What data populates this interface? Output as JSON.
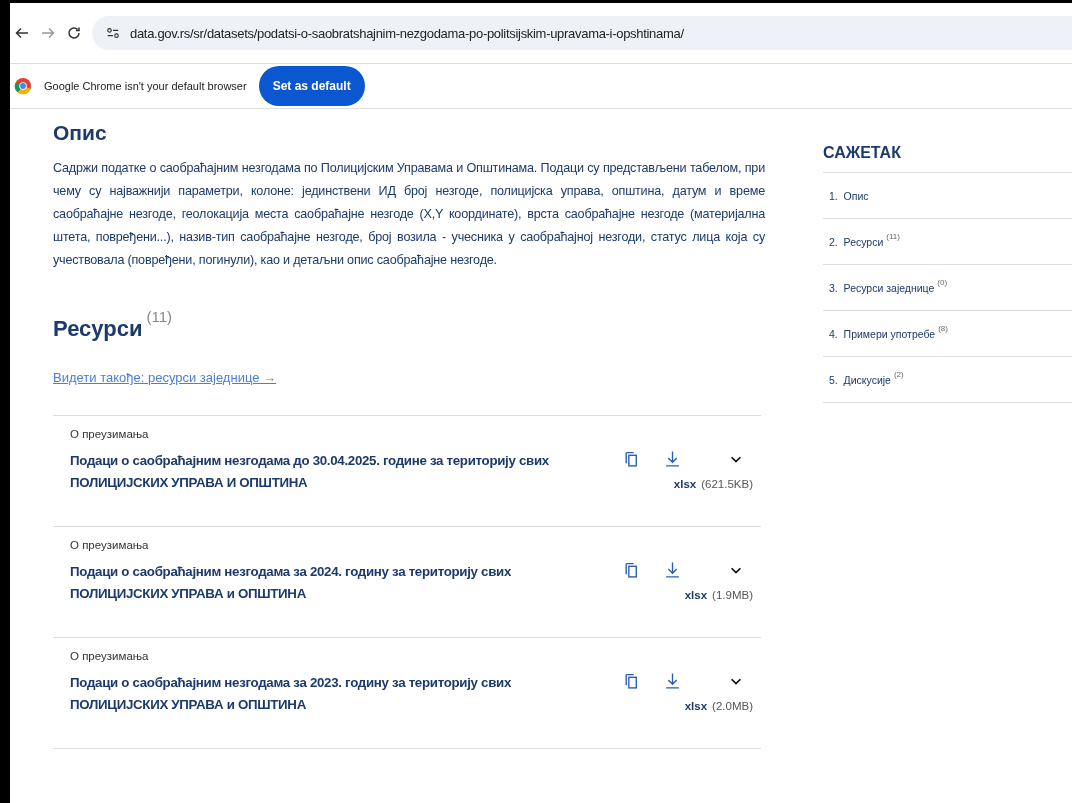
{
  "browser": {
    "url": "data.gov.rs/sr/datasets/podatsi-o-saobratshajnim-nezgodama-po-politsijskim-upravama-i-opshtinama/"
  },
  "infobar": {
    "message": "Google Chrome isn't your default browser",
    "button": "Set as default"
  },
  "description": {
    "heading": "Опис",
    "text": "Садржи податке о саобраћајним незгодама по Полицијским Управама и Општинама. Подаци су представљени табелом, при чему су најважнији параметри, колоне: јединствени ИД број незгоде, полицијска управа, општина, датум и време саобраћајне незгоде, геолокација места саобраћајне незгоде (X,Y координате), врста саобраћајне незгоде (материјална штета, повређени...), назив-тип саобраћајне незгоде, број возила - учесника у саобраћајној незгоди, статус лица која су учествовала (повређени, погинули), као и детаљни опис саобраћајне незгоде."
  },
  "resources": {
    "heading": "Ресурси",
    "count": "(11)",
    "see_also": "Видети такође: ресурси заједнице",
    "see_also_arrow": "→",
    "items": [
      {
        "label": "О преузимања",
        "title": "Подаци о саобраћајним незгодама до 30.04.2025. године за територију свих ПОЛИЦИЈСКИХ УПРАВА И ОПШТИНА",
        "format": "xlsx",
        "size": "(621.5KB)",
        "expanded": false
      },
      {
        "label": "О преузимања",
        "title": "Подаци о саобраћајним незгодама за 2024. годину за територију свих ПОЛИЦИЈСКИХ УПРАВА и ОПШТИНА",
        "format": "xlsx",
        "size": "(1.9MB)",
        "expanded": false
      },
      {
        "label": "О преузимања",
        "title": "Подаци о саобраћајним незгодама за 2023. годину за територију свих ПОЛИЦИЈСКИХ УПРАВА и ОПШТИНА",
        "format": "xlsx",
        "size": "(2.0MB)",
        "expanded": false
      }
    ]
  },
  "summary": {
    "heading": "САЖЕТАК",
    "items": [
      {
        "number": "1.",
        "label": "Опис"
      },
      {
        "number": "2.",
        "label": "Ресурси",
        "count": "(11)"
      },
      {
        "number": "3.",
        "label": "Ресурси заједнице",
        "count": "(0)"
      },
      {
        "number": "4.",
        "label": "Примери употребе",
        "count": "(8)"
      },
      {
        "number": "5.",
        "label": "Дискусије",
        "count": "(2)"
      }
    ]
  }
}
